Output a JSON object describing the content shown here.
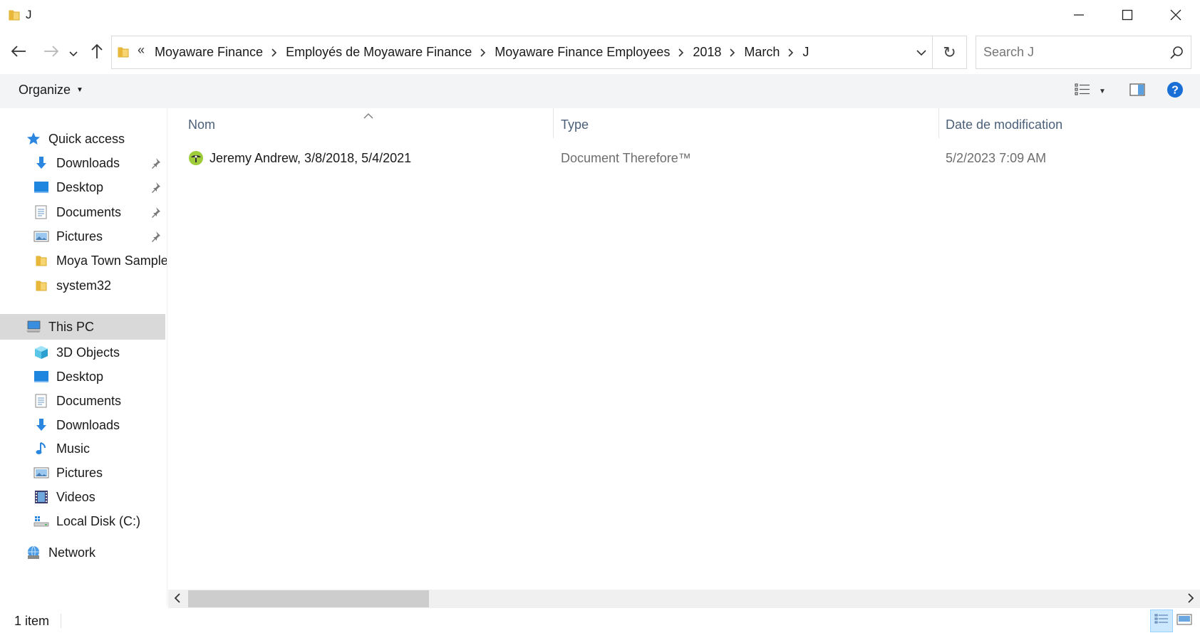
{
  "window": {
    "title": "J",
    "minimize_icon": "minimize-icon",
    "maximize_icon": "maximize-icon",
    "close_icon": "close-icon"
  },
  "nav": {
    "back_icon": "arrow-left-icon",
    "forward_icon": "arrow-right-icon",
    "recent_icon": "chevron-down-icon",
    "up_icon": "arrow-up-icon"
  },
  "address": {
    "overflow": "«",
    "crumbs": [
      "Moyaware Finance",
      "Employés de Moyaware Finance",
      "Moyaware Finance Employees",
      "2018",
      "March",
      "J"
    ],
    "refresh_glyph": "↻"
  },
  "search": {
    "placeholder": "Search J"
  },
  "command_bar": {
    "organize_label": "Organize"
  },
  "sidebar": {
    "quick_access": "Quick access",
    "quick_items": [
      {
        "label": "Downloads",
        "icon": "download-arrow-icon",
        "pinned": true
      },
      {
        "label": "Desktop",
        "icon": "desktop-icon",
        "pinned": true
      },
      {
        "label": "Documents",
        "icon": "documents-icon",
        "pinned": true
      },
      {
        "label": "Pictures",
        "icon": "pictures-icon",
        "pinned": true
      },
      {
        "label": "Moya Town Sample",
        "icon": "folder-icon",
        "pinned": false
      },
      {
        "label": "system32",
        "icon": "folder-icon",
        "pinned": false
      }
    ],
    "this_pc": "This PC",
    "pc_items": [
      {
        "label": "3D Objects",
        "icon": "cube-icon"
      },
      {
        "label": "Desktop",
        "icon": "desktop-icon"
      },
      {
        "label": "Documents",
        "icon": "documents-icon"
      },
      {
        "label": "Downloads",
        "icon": "download-arrow-icon"
      },
      {
        "label": "Music",
        "icon": "music-note-icon"
      },
      {
        "label": "Pictures",
        "icon": "pictures-icon"
      },
      {
        "label": "Videos",
        "icon": "film-icon"
      },
      {
        "label": "Local Disk (C:)",
        "icon": "drive-icon"
      }
    ],
    "network": "Network"
  },
  "file_list": {
    "columns": [
      "Nom",
      "Type",
      "Date de modification"
    ],
    "rows": [
      {
        "name": "Jeremy Andrew, 3/8/2018, 5/4/2021",
        "type": "Document Therefore™",
        "date": "5/2/2023 7:09 AM"
      }
    ]
  },
  "status": {
    "count": "1 item"
  },
  "colors": {
    "accent": "#1a73c7",
    "header_text": "#4c607a",
    "selected_bg": "#d9d9d9",
    "folder": "#f7d472",
    "help_blue": "#1a6fd6"
  }
}
